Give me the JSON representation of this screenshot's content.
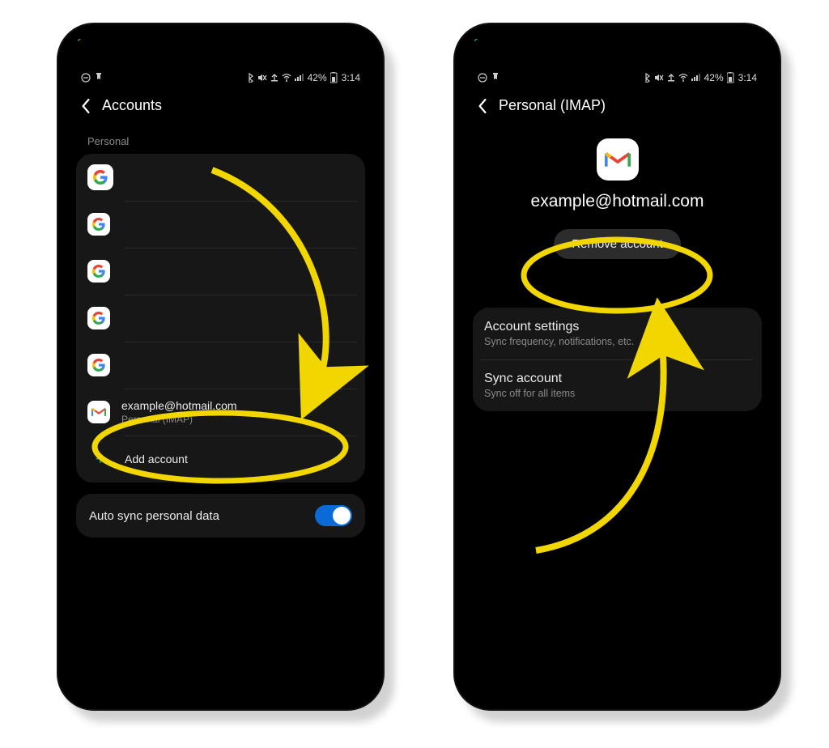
{
  "status": {
    "battery_text": "42%",
    "time": "3:14"
  },
  "left": {
    "title": "Accounts",
    "section_label": "Personal",
    "item_email": "example@hotmail.com",
    "item_email_sub": "Personal (IMAP)",
    "add_account": "Add account",
    "auto_sync": "Auto sync personal data"
  },
  "right": {
    "title": "Personal (IMAP)",
    "email": "example@hotmail.com",
    "remove_btn": "Remove account",
    "settings_title": "Account settings",
    "settings_sub": "Sync frequency, notifications, etc.",
    "sync_title": "Sync account",
    "sync_sub": "Sync off for all items"
  }
}
